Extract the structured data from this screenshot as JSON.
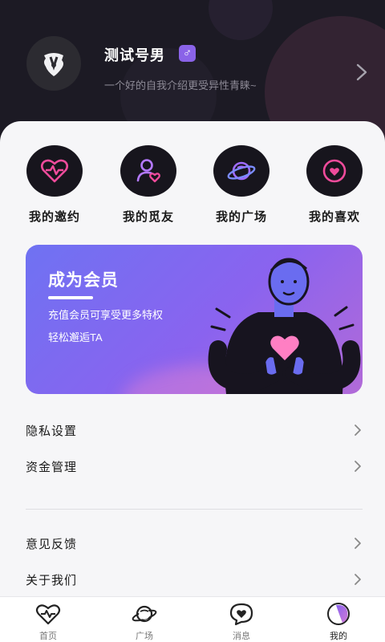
{
  "profile": {
    "name": "测试号男",
    "gender_symbol": "♂",
    "bio": "一个好的自我介绍更受异性青睐~"
  },
  "quick_actions": [
    {
      "label": "我的邀约",
      "icon": "heart-pulse-icon"
    },
    {
      "label": "我的觅友",
      "icon": "user-heart-icon"
    },
    {
      "label": "我的广场",
      "icon": "planet-icon"
    },
    {
      "label": "我的喜欢",
      "icon": "heart-circle-icon"
    }
  ],
  "banner": {
    "title": "成为会员",
    "line1": "充值会员可享受更多特权",
    "line2": "轻松邂逅TA"
  },
  "menu": [
    {
      "label": "隐私设置"
    },
    {
      "label": "资金管理"
    },
    {
      "label": "意见反馈"
    },
    {
      "label": "关于我们"
    }
  ],
  "tabs": [
    {
      "label": "首页",
      "icon": "heart-pulse-icon"
    },
    {
      "label": "广场",
      "icon": "planet-icon"
    },
    {
      "label": "消息",
      "icon": "chat-heart-icon"
    },
    {
      "label": "我的",
      "icon": "profile-icon",
      "active": true
    }
  ],
  "colors": {
    "accent": "#8a63e8",
    "neon_pink": "#f04b9b",
    "neon_purple": "#a06cff"
  }
}
